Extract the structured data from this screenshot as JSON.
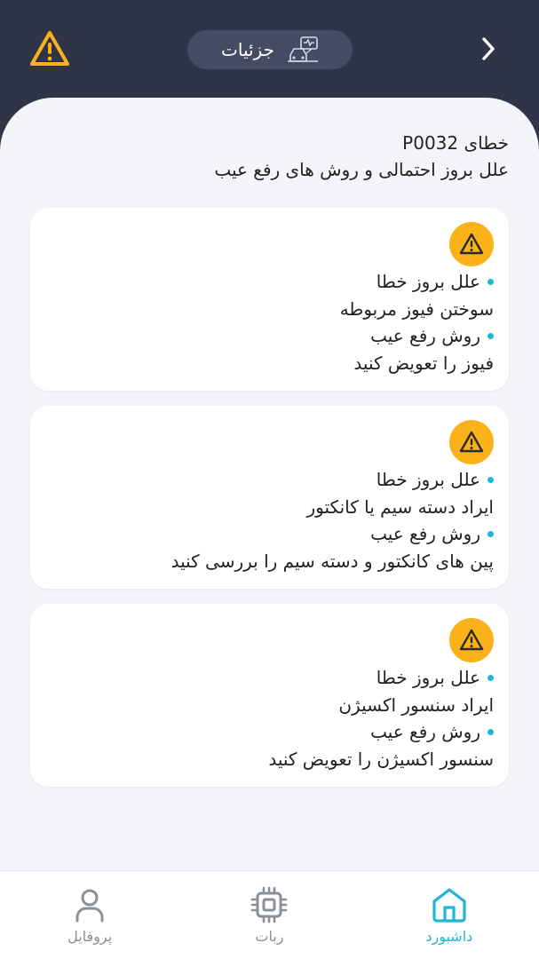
{
  "header": {
    "title": "جزئیات",
    "back_icon": "chevron-right-icon",
    "alert_icon": "warning-triangle-icon",
    "title_icon": "car-diagnostic-icon"
  },
  "heading": {
    "code_line": "خطای P0032",
    "subtitle": "علل بروز احتمالی و روش های رفع عیب"
  },
  "cards": [
    {
      "cause_label": "علل بروز خطا",
      "cause": "سوختن فیوز مربوطه",
      "fix_label": "روش رفع عیب",
      "fix": "فیوز را تعویض کنید"
    },
    {
      "cause_label": "علل بروز خطا",
      "cause": "ایراد دسته سیم یا کانکتور",
      "fix_label": "روش رفع عیب",
      "fix": "پین های کانکتور و دسته سیم را بررسی کنید"
    },
    {
      "cause_label": "علل بروز خطا",
      "cause": "ایراد سنسور اکسیژن",
      "fix_label": "روش رفع عیب",
      "fix": "سنسور اکسیژن را تعویض کنید"
    }
  ],
  "nav": {
    "dashboard": "داشبورد",
    "robot": "ربات",
    "profile": "پروفایل"
  },
  "colors": {
    "header_bg": "#2f3447",
    "accent": "#1fb5d4",
    "warning": "#fbb11a",
    "content_bg": "#f4f5f9"
  }
}
